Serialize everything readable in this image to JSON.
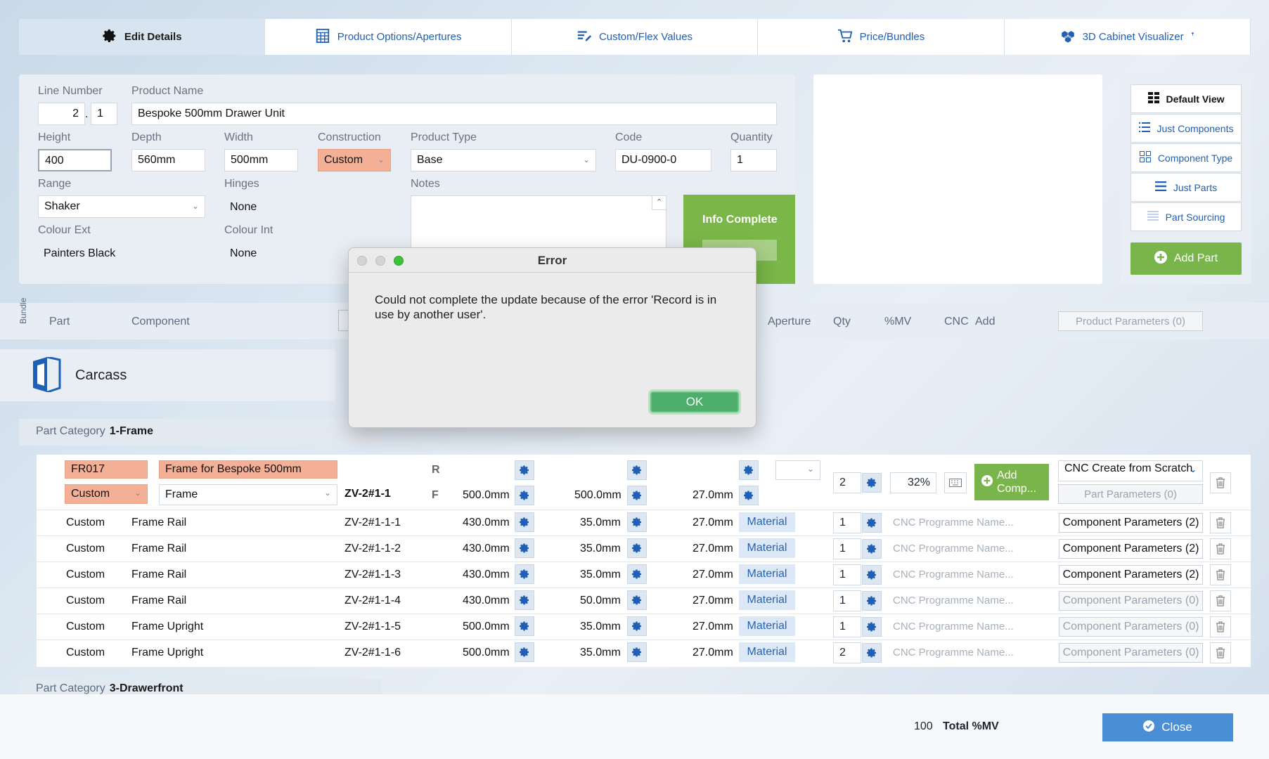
{
  "tabs": [
    {
      "label": "Edit Details",
      "icon": "gear-icon"
    },
    {
      "label": "Product Options/Apertures",
      "icon": "spreadsheet-icon"
    },
    {
      "label": "Custom/Flex Values",
      "icon": "edit-list-icon"
    },
    {
      "label": "Price/Bundles",
      "icon": "cart-icon"
    },
    {
      "label": "3D Cabinet Visualizer",
      "icon": "cubes-icon",
      "badge": "ꜛ"
    }
  ],
  "form": {
    "line_number_label": "Line Number",
    "line_a": "2",
    "line_sep": ".",
    "line_b": "1",
    "product_name_label": "Product Name",
    "product_name": "Bespoke 500mm Drawer Unit",
    "height_label": "Height",
    "height": "400",
    "depth_label": "Depth",
    "depth": "560mm",
    "width_label": "Width",
    "width": "500mm",
    "construction_label": "Construction",
    "construction": "Custom",
    "product_type_label": "Product Type",
    "product_type": "Base",
    "code_label": "Code",
    "code": "DU-0900-0",
    "quantity_label": "Quantity",
    "quantity": "1",
    "range_label": "Range",
    "range": "Shaker",
    "hinges_label": "Hinges",
    "hinges": "None",
    "notes_label": "Notes",
    "colour_ext_label": "Colour Ext",
    "colour_ext": "Painters Black",
    "colour_int_label": "Colour Int",
    "colour_int": "None",
    "info_complete": "Info Complete"
  },
  "views": {
    "default_view": "Default View",
    "just_components": "Just Components",
    "component_type": "Component Type",
    "just_parts": "Just Parts",
    "part_sourcing": "Part Sourcing",
    "add_part": "Add Part"
  },
  "columns": {
    "bundle": "Bundle",
    "part": "Part",
    "component": "Component",
    "aperture": "Aperture",
    "qty": "Qty",
    "mv": "%MV",
    "cnc": "CNC",
    "add": "Add",
    "product_params": "Product Parameters (0)"
  },
  "carcass": "Carcass",
  "part_category_1": {
    "label": "Part Category",
    "value": "1-Frame"
  },
  "part_category_2": {
    "label": "Part Category",
    "value": "3-Drawerfront"
  },
  "frame": {
    "code": "FR017",
    "name": "Frame for Bespoke 500mm",
    "construction": "Custom",
    "type": "Frame",
    "ref": "ZV-2#1-1",
    "r_label": "R",
    "f_label": "F",
    "dim1": "500.0mm",
    "dim2": "500.0mm",
    "dim3": "27.0mm",
    "qty": "2",
    "mv": "32%",
    "add_comp": "Add Comp...",
    "cnc_select": "CNC Create from Scratch",
    "part_params": "Part Parameters (0)"
  },
  "rows": [
    {
      "construction": "Custom",
      "name": "Frame Rail",
      "ref": "ZV-2#1-1-1",
      "d1": "430.0mm",
      "d2": "35.0mm",
      "d3": "27.0mm",
      "material": "Material",
      "qty": "1",
      "cnc": "CNC Programme Name...",
      "params": "Component Parameters (2)",
      "params_active": true
    },
    {
      "construction": "Custom",
      "name": "Frame Rail",
      "ref": "ZV-2#1-1-2",
      "d1": "430.0mm",
      "d2": "35.0mm",
      "d3": "27.0mm",
      "material": "Material",
      "qty": "1",
      "cnc": "CNC Programme Name...",
      "params": "Component Parameters (2)",
      "params_active": true
    },
    {
      "construction": "Custom",
      "name": "Frame Rail",
      "ref": "ZV-2#1-1-3",
      "d1": "430.0mm",
      "d2": "35.0mm",
      "d3": "27.0mm",
      "material": "Material",
      "qty": "1",
      "cnc": "CNC Programme Name...",
      "params": "Component Parameters (2)",
      "params_active": true
    },
    {
      "construction": "Custom",
      "name": "Frame Rail",
      "ref": "ZV-2#1-1-4",
      "d1": "430.0mm",
      "d2": "50.0mm",
      "d3": "27.0mm",
      "material": "Material",
      "qty": "1",
      "cnc": "CNC Programme Name...",
      "params": "Component Parameters (0)",
      "params_active": false
    },
    {
      "construction": "Custom",
      "name": "Frame Upright",
      "ref": "ZV-2#1-1-5",
      "d1": "500.0mm",
      "d2": "35.0mm",
      "d3": "27.0mm",
      "material": "Material",
      "qty": "1",
      "cnc": "CNC Programme Name...",
      "params": "Component Parameters (0)",
      "params_active": false
    },
    {
      "construction": "Custom",
      "name": "Frame Upright",
      "ref": "ZV-2#1-1-6",
      "d1": "500.0mm",
      "d2": "35.0mm",
      "d3": "27.0mm",
      "material": "Material",
      "qty": "2",
      "cnc": "CNC Programme Name...",
      "params": "Component Parameters (0)",
      "params_active": false
    }
  ],
  "footer": {
    "total_value": "100",
    "total_label": "Total %MV",
    "close": "Close"
  },
  "dialog": {
    "title": "Error",
    "message": "Could not complete the update because of the error 'Record is in use by another user'.",
    "ok": "OK"
  },
  "colors": {
    "accent": "#4a8fd6",
    "green": "#79b54a",
    "orange": "#f3b096",
    "link": "#1f5fb5"
  }
}
